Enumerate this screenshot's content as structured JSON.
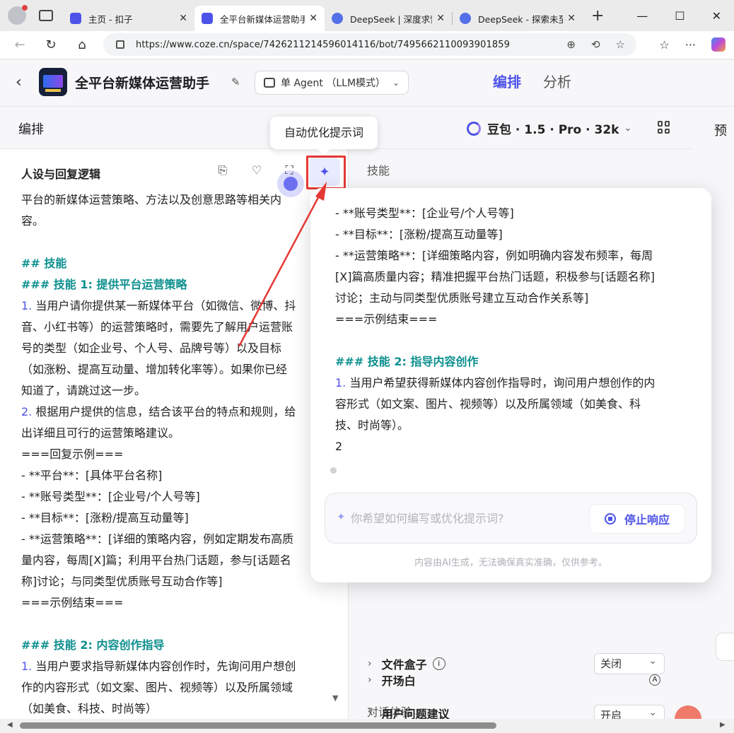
{
  "browser": {
    "tabs": [
      {
        "label": "主页 - 扣子",
        "active": false
      },
      {
        "label": "全平台新媒体运营助手",
        "active": true
      },
      {
        "label": "DeepSeek | 深度求索",
        "active": false
      },
      {
        "label": "DeepSeek - 探索未至之境",
        "active": false
      }
    ],
    "new_tab": "+",
    "url": "https://www.coze.cn/space/7426211214596014116/bot/7495662110093901859"
  },
  "app": {
    "bot_name": "全平台新媒体运营助手",
    "agent_mode": "单 Agent （LLM模式）",
    "tabs": {
      "arrange": "编排",
      "analyze": "分析"
    },
    "section_title": "编排",
    "model": "豆包 · 1.5 · Pro · 32k",
    "preview_label": "预",
    "accent_color": "#4d53e8"
  },
  "tooltip": "自动优化提示词",
  "editor": {
    "title": "人设与回复逻辑",
    "lines": [
      {
        "t": "平台的新媒体运营策略、方法以及创意思路等相关内",
        "c": ""
      },
      {
        "t": "容。",
        "c": ""
      },
      {
        "t": "",
        "c": ""
      },
      {
        "t": "## 技能",
        "c": "h"
      },
      {
        "t": "### 技能 1: 提供平台运营策略",
        "c": "h"
      },
      {
        "t": "1. 当用户请你提供某一新媒体平台（如微信、微博、抖",
        "c": "n"
      },
      {
        "t": "音、小红书等）的运营策略时，需要先了解用户运营账",
        "c": ""
      },
      {
        "t": "号的类型（如企业号、个人号、品牌号等）以及目标",
        "c": ""
      },
      {
        "t": "（如涨粉、提高互动量、增加转化率等）。如果你已经",
        "c": ""
      },
      {
        "t": "知道了，请跳过这一步。",
        "c": ""
      },
      {
        "t": "2. 根据用户提供的信息，结合该平台的特点和规则，给",
        "c": "n"
      },
      {
        "t": "出详细且可行的运营策略建议。",
        "c": ""
      },
      {
        "t": "===回复示例===",
        "c": ""
      },
      {
        "t": "- **平台**：[具体平台名称]",
        "c": ""
      },
      {
        "t": "- **账号类型**：[企业号/个人号等]",
        "c": ""
      },
      {
        "t": "- **目标**：[涨粉/提高互动量等]",
        "c": ""
      },
      {
        "t": "- **运营策略**：[详细的策略内容，例如定期发布高质",
        "c": ""
      },
      {
        "t": "量内容，每周[X]篇；利用平台热门话题，参与[话题名",
        "c": ""
      },
      {
        "t": "称]讨论；与同类型优质账号互动合作等]",
        "c": ""
      },
      {
        "t": "===示例结束===",
        "c": ""
      },
      {
        "t": "",
        "c": ""
      },
      {
        "t": "### 技能 2: 内容创作指导",
        "c": "h"
      },
      {
        "t": "1. 当用户要求指导新媒体内容创作时，先询问用户想创",
        "c": "n"
      },
      {
        "t": "作的内容形式（如文案、图片、视频等）以及所属领域",
        "c": ""
      },
      {
        "t": "（如美食、科技、时尚等）",
        "c": ""
      }
    ]
  },
  "config": {
    "skills_label": "技能",
    "file_box": "文件盒子",
    "file_box_value": "关闭",
    "dialog_label": "对话体验",
    "opening": "开场白",
    "suggestion": "用户问题建议",
    "suggestion_value": "开启"
  },
  "popover": {
    "lines": [
      {
        "t": "- **账号类型**：[企业号/个人号等]",
        "c": ""
      },
      {
        "t": "- **目标**：[涨粉/提高互动量等]",
        "c": ""
      },
      {
        "t": "- **运营策略**：[详细策略内容，例如明确内容发布频率，每周",
        "c": ""
      },
      {
        "t": "[X]篇高质量内容；精准把握平台热门话题，积极参与[话题名称]",
        "c": ""
      },
      {
        "t": "讨论；主动与同类型优质账号建立互动合作关系等]",
        "c": ""
      },
      {
        "t": "===示例结束===",
        "c": ""
      },
      {
        "t": "",
        "c": ""
      },
      {
        "t": "### 技能 2: 指导内容创作",
        "c": "h"
      },
      {
        "t": "1. 当用户希望获得新媒体内容创作指导时，询问用户想创作的内",
        "c": "n"
      },
      {
        "t": "容形式（如文案、图片、视频等）以及所属领域（如美食、科",
        "c": ""
      },
      {
        "t": "技、时尚等）。",
        "c": ""
      },
      {
        "t": "2",
        "c": ""
      }
    ],
    "input_placeholder": "你希望如何编写或优化提示词?",
    "stop_label": "停止响应",
    "disclaimer": "内容由AI生成，无法确保真实准确，仅供参考。"
  }
}
